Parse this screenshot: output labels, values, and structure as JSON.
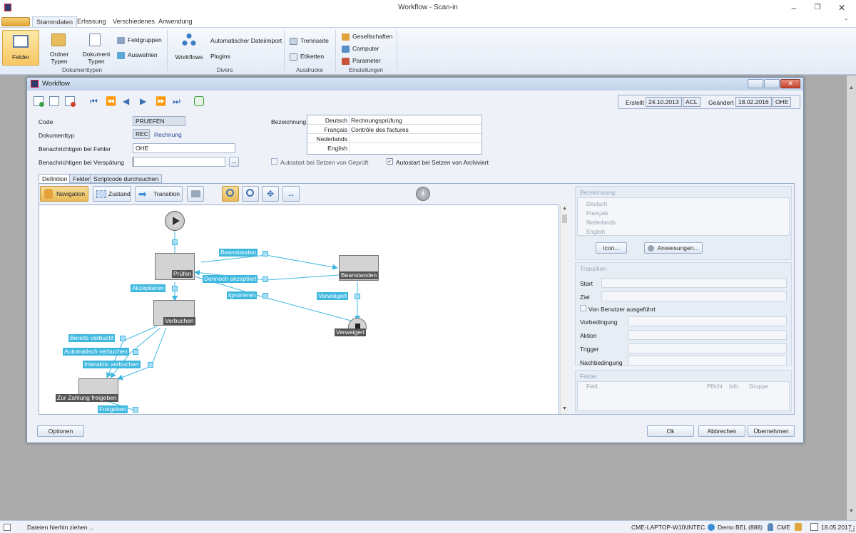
{
  "window": {
    "title": "Workflow - Scan-in"
  },
  "menu": {
    "tabs": [
      "Stammdaten",
      "Erfassung",
      "Verschiedenes",
      "Anwendung"
    ]
  },
  "ribbon": {
    "felder": "Felder",
    "ordner_typen": "Ordner\nTypen",
    "dokument_typen": "Dokument\nTypen",
    "feldgruppen": "Feldgruppen",
    "auswahlen": "Auswahlen",
    "group_dokumenttypen": "Dokumenttypen",
    "workflows": "Workflows",
    "automatischer_dateiimport": "Automatischer Dateiimport",
    "plugins": "Plugins",
    "group_divers": "Divers",
    "trennseite": "Trennseite",
    "etiketten": "Etiketten",
    "group_ausdrucke": "Ausdrucke",
    "gesellschaften": "Gesellschaften",
    "computer": "Computer",
    "parameter": "Parameter",
    "group_einstellungen": "Einstellungen"
  },
  "dialog": {
    "title": "Workflow",
    "erstellt_label": "Erstellt",
    "erstellt_date": "24.10.2013",
    "erstellt_user": "ACL",
    "geaendert_label": "Geändert",
    "geaendert_date": "18.02.2016",
    "geaendert_user": "OHE",
    "code_label": "Code",
    "code_value": "PRUEFEN",
    "dokumenttyp_label": "Dokumenttyp",
    "dokumenttyp_code": "REC",
    "dokumenttyp_name": "Rechnung",
    "fehler_label": "Benachrichtigen bei Fehler",
    "fehler_value": "OHE",
    "verspaetung_label": "Benachrichtigen bei Verspätung",
    "verspaetung_value": "",
    "bezeichnung_label": "Bezeichnung",
    "bezeichnung": [
      {
        "lang": "Deutsch",
        "text": "Rechnungsprüfung"
      },
      {
        "lang": "Français",
        "text": "Contrôle des factures"
      },
      {
        "lang": "Nederlands",
        "text": ""
      },
      {
        "lang": "English",
        "text": ""
      }
    ],
    "autostart_geprueft": "Autostart bei Setzen von Geprüft",
    "autostart_archiviert": "Autostart bei Setzen von Archiviert",
    "autostart_geprueft_checked": false,
    "autostart_archiviert_checked": true,
    "tabs": [
      "Definition",
      "Felder",
      "Scriptcode durchsuchen"
    ],
    "tool_navigation": "Navigation",
    "tool_zustand": "Zustand",
    "tool_transition": "Transition",
    "optionen": "Optionen",
    "ok": "Ok",
    "abbrechen": "Abbrechen",
    "uebernehmen": "Übernehmen"
  },
  "diagram": {
    "states": {
      "pruefen": "Prüfen",
      "beanstanden": "Beanstanden",
      "verbuchen": "Verbuchen",
      "verweigert": "Verweigert",
      "zahlung": "Zur Zahlung freigeben"
    },
    "transitions": {
      "beanstanden": "Beanstanden",
      "dennoch": "Dennoch akzeptiert",
      "ignorieren": "Ignorieren",
      "verweigert": "Verweigert",
      "akzeptieren": "Akzeptieren",
      "bereits": "Bereits verbucht",
      "automatisch": "Automatisch verbuchen",
      "interaktiv": "Interaktiv verbuchen",
      "freigeben": "Freigeben"
    }
  },
  "panel": {
    "bezeichnung_head": "Bezeichnung",
    "langs": [
      "Deutsch",
      "Français",
      "Nederlands",
      "English"
    ],
    "icon_btn": "Icon...",
    "anweisungen_btn": "Anweisungen...",
    "transition_head": "Transition",
    "start": "Start",
    "ziel": "Ziel",
    "von_benutzer": "Von Benutzer ausgeführt",
    "vorbedingung": "Vorbedingung",
    "aktion": "Aktion",
    "trigger": "Trigger",
    "nachbedingung": "Nachbedingung",
    "felder_head": "Felder",
    "cols": [
      "Feld",
      "Pflicht",
      "Info",
      "Gruppe"
    ]
  },
  "status": {
    "hint": "Dateien hierhin ziehen ...",
    "host": "CME-LAPTOP-W10\\INTEC",
    "db": "Demo BEL (888)",
    "user": "CME",
    "date": "18.05.2017"
  }
}
